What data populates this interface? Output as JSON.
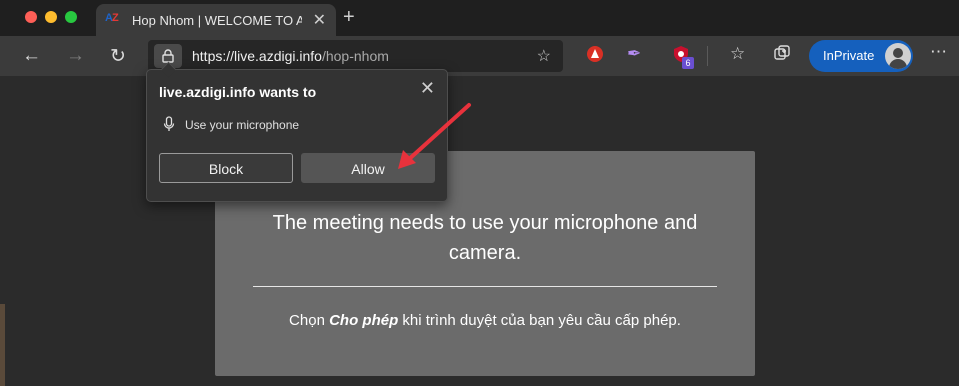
{
  "window": {
    "controls": [
      "close",
      "minimize",
      "maximize"
    ]
  },
  "tab": {
    "favicon_text_a": "A",
    "favicon_text_z": "Z",
    "title": "Hop Nhom | WELCOME TO AZDIGI",
    "close": "✕",
    "new_tab": "+"
  },
  "toolbar": {
    "back": "←",
    "forward": "→",
    "reload": "↻",
    "url_host": "https://live.azdigi.info",
    "url_path": "/hop-nhom",
    "ext_badge": "6",
    "inprivate": "InPrivate",
    "menu": "⋯"
  },
  "popup": {
    "title": "live.azdigi.info wants to",
    "permission": "Use your microphone",
    "close": "✕",
    "block_label": "Block",
    "allow_label": "Allow"
  },
  "card": {
    "title": "The meeting needs to use your microphone and camera.",
    "note_pre": "Chọn ",
    "note_bold": "Cho phép",
    "note_post": " khi trình duyệt của bạn yêu cầu cấp phép."
  },
  "colors": {
    "accent": "#1560bd",
    "annotation_arrow": "#e8323c"
  }
}
